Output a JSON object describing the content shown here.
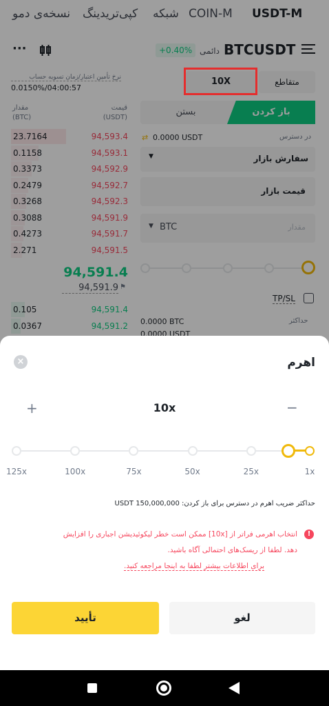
{
  "tabs": [
    "USDT-M",
    "COIN-M",
    "شبکه",
    "کپی‌تریدینگ",
    "نسخه‌ی دمو"
  ],
  "header": {
    "symbol": "BTCUSDT",
    "contract_type": "دائمی",
    "change": "+0.40%",
    "more": "···"
  },
  "funding": {
    "label": "نرخ تأمین اعتبار/زمان تسویه حساب",
    "value": "0.0150%/04:00:57"
  },
  "orderbook": {
    "price_header": "قیمت\n(USDT)",
    "qty_header": "مقدار\n(BTC)",
    "asks": [
      {
        "price": "94,593.4",
        "qty": "23.7164"
      },
      {
        "price": "94,593.1",
        "qty": "0.1158"
      },
      {
        "price": "94,592.9",
        "qty": "0.3373"
      },
      {
        "price": "94,592.7",
        "qty": "0.2479"
      },
      {
        "price": "94,592.3",
        "qty": "0.3268"
      },
      {
        "price": "94,591.9",
        "qty": "0.3088"
      },
      {
        "price": "94,591.7",
        "qty": "0.4273"
      },
      {
        "price": "94,591.5",
        "qty": "2.271"
      }
    ],
    "last_price": "94,591.4",
    "mark_price": "94,591.9",
    "bids": [
      {
        "price": "94,591.4",
        "qty": "0.105"
      },
      {
        "price": "94,591.2",
        "qty": "0.0367"
      }
    ]
  },
  "order_form": {
    "margin_mode": "متقاطع",
    "leverage": "10X",
    "open_tab": "باز کردن",
    "close_tab": "بستن",
    "available_label": "در دسترس",
    "available_value": "0.0000 USDT",
    "order_type": "سفارش بازار",
    "price_field": "قیمت بازار",
    "amount_placeholder": "مقدار",
    "amount_unit": "BTC",
    "tpsl": "TP/SL",
    "max_label": "حداکثر",
    "max_value": "0.0000 BTC",
    "max_value2": "0.0000 USDT"
  },
  "sheet": {
    "title": "اهرم",
    "value": "10x",
    "minus": "−",
    "plus": "+",
    "marks": [
      "1x",
      "25x",
      "50x",
      "75x",
      "100x",
      "125x"
    ],
    "slider_fraction": 0.072,
    "max_position": "حداکثر ضریب اهرم در دسترس برای باز کردن: 150,000,000 USDT",
    "warning_line1": "انتخاب اهرمی فراتر از [10x] ممکن است خطر لیکوئیدیشن اجباری را افزایش",
    "warning_line2": "دهد. لطفا از ریسک‌های احتمالی آگاه باشید.",
    "warning_link": "برای اطلاعات بیشتر لطفا به اینجا مراجعه کنید.",
    "cancel": "لغو",
    "confirm": "تأیید"
  },
  "colors": {
    "accent": "#fcd535",
    "buy": "#0ecb81",
    "sell": "#f6465d",
    "highlight_box": "#e52d2d"
  }
}
